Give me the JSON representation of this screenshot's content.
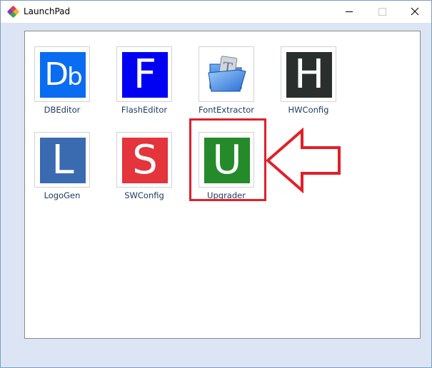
{
  "window": {
    "title": "LaunchPad",
    "controls": {
      "minimize_icon": "minimize-icon",
      "maximize_icon": "maximize-icon",
      "close_icon": "close-icon"
    }
  },
  "apps": [
    {
      "label": "DBEditor",
      "glyph": "Db",
      "color": "#0a6cf0",
      "icon": "db-editor-icon"
    },
    {
      "label": "FlashEditor",
      "glyph": "F",
      "color": "#0000f2",
      "icon": "flash-editor-icon"
    },
    {
      "label": "FontExtractor",
      "glyph": "",
      "color": "#ffffff",
      "icon": "blue-folder-icon"
    },
    {
      "label": "HWConfig",
      "glyph": "H",
      "color": "#2a2f2e",
      "icon": "hw-config-icon"
    },
    {
      "label": "LogoGen",
      "glyph": "L",
      "color": "#3a6bb0",
      "icon": "logo-gen-icon"
    },
    {
      "label": "SWConfig",
      "glyph": "S",
      "color": "#e4343c",
      "icon": "sw-config-icon"
    },
    {
      "label": "Upgrader",
      "glyph": "U",
      "color": "#248a2a",
      "icon": "upgrader-icon"
    }
  ],
  "annotation": {
    "highlight_color": "#e0202a",
    "highlighted_app": "Upgrader",
    "arrow_direction": "left"
  },
  "colors": {
    "client_background": "#dbe5f3",
    "label_text": "#1f3a66"
  }
}
